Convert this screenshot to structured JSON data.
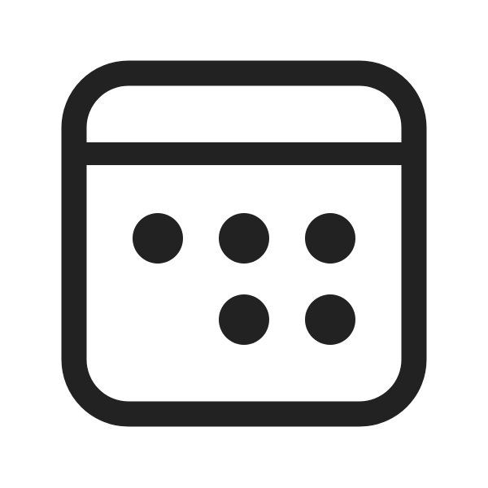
{
  "icon": {
    "name": "calendar-icon",
    "stroke_color": "#222222",
    "background_color": "#ffffff"
  }
}
